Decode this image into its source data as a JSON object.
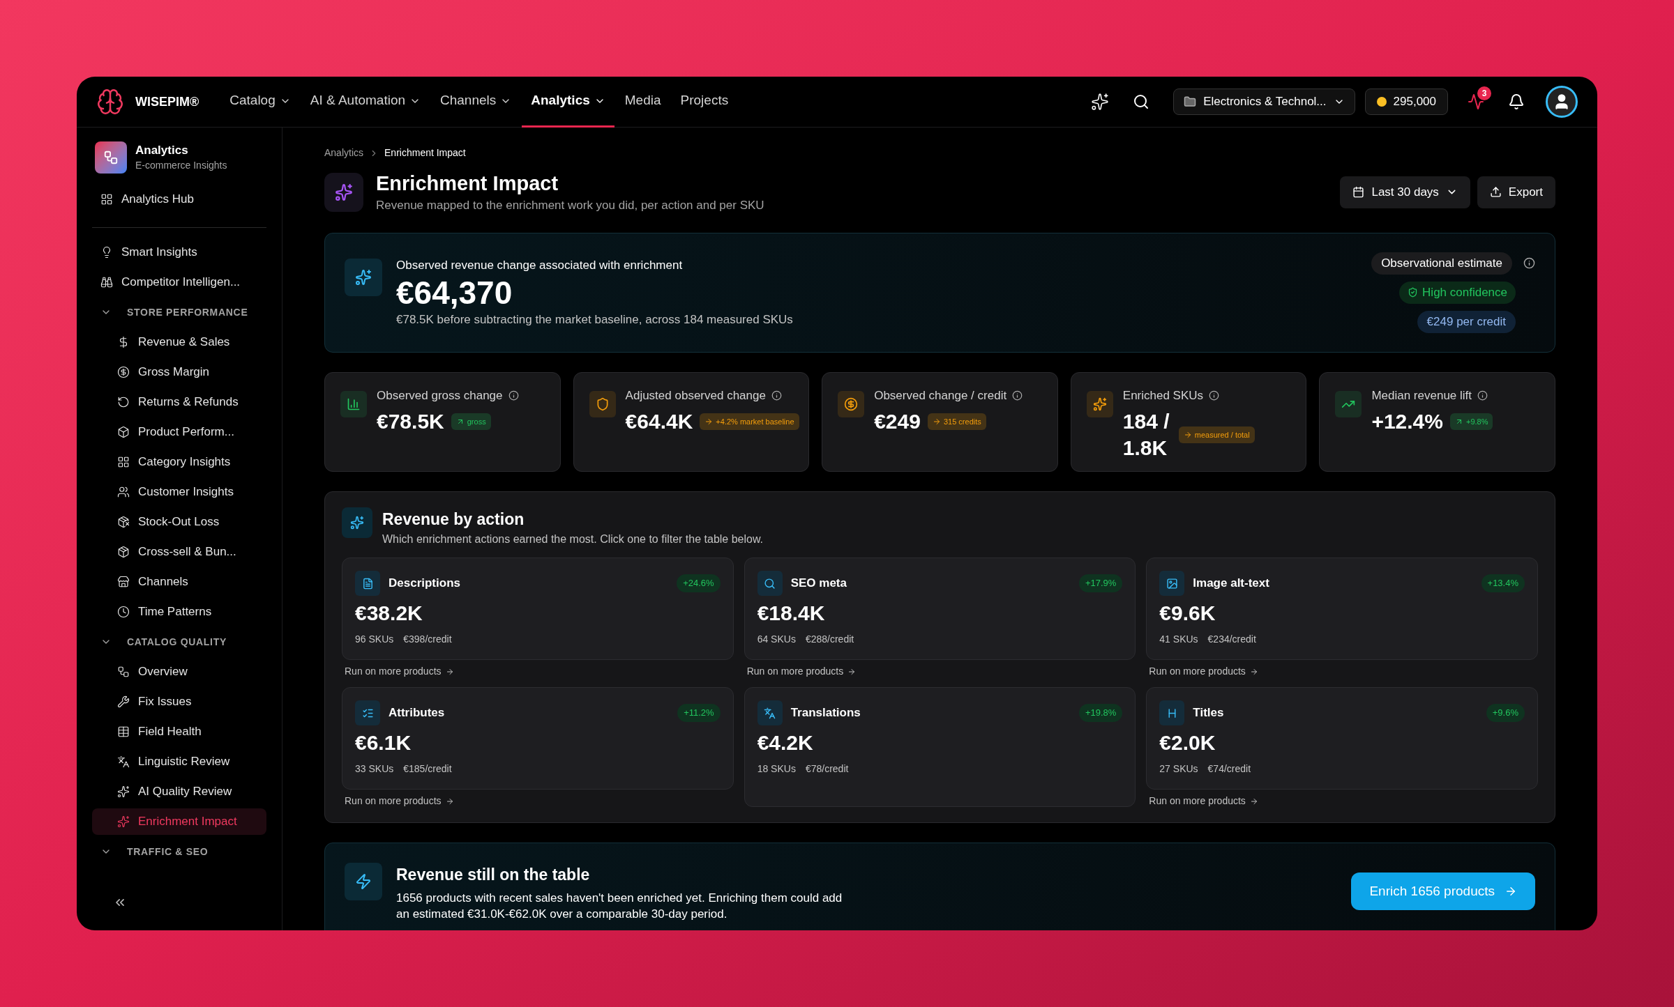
{
  "nav": {
    "brand": "WISEPIM®",
    "items": [
      {
        "label": "Catalog",
        "menu": true,
        "selected": false
      },
      {
        "label": "AI & Automation",
        "menu": true,
        "selected": false
      },
      {
        "label": "Channels",
        "menu": true,
        "selected": false
      },
      {
        "label": "Analytics",
        "menu": true,
        "selected": true
      },
      {
        "label": "Media",
        "menu": false,
        "selected": false
      },
      {
        "label": "Projects",
        "menu": false,
        "selected": false
      }
    ],
    "workspace": "Electronics & Technol...",
    "credits": "295,000",
    "notifications": "3"
  },
  "sidebar": {
    "title": "Analytics",
    "subtitle": "E-commerce Insights",
    "top": [
      {
        "label": "Analytics Hub",
        "selected": false
      }
    ],
    "items": [
      {
        "label": "Smart Insights",
        "selected": false
      },
      {
        "label": "Competitor Intelligen...",
        "selected": false
      }
    ],
    "sections": [
      {
        "label": "STORE PERFORMANCE",
        "expanded": true,
        "children": [
          {
            "label": "Revenue & Sales",
            "selected": false
          },
          {
            "label": "Gross Margin",
            "selected": false
          },
          {
            "label": "Returns & Refunds",
            "selected": false
          },
          {
            "label": "Product Perform...",
            "selected": false
          },
          {
            "label": "Category Insights",
            "selected": false
          },
          {
            "label": "Customer Insights",
            "selected": false
          },
          {
            "label": "Stock-Out Loss",
            "selected": false
          },
          {
            "label": "Cross-sell & Bun...",
            "selected": false
          },
          {
            "label": "Channels",
            "selected": false
          },
          {
            "label": "Time Patterns",
            "selected": false
          }
        ]
      },
      {
        "label": "CATALOG QUALITY",
        "expanded": true,
        "children": [
          {
            "label": "Overview",
            "selected": false
          },
          {
            "label": "Fix Issues",
            "selected": false
          },
          {
            "label": "Field Health",
            "selected": false
          },
          {
            "label": "Linguistic Review",
            "selected": false
          },
          {
            "label": "AI Quality Review",
            "selected": false
          },
          {
            "label": "Enrichment Impact",
            "selected": true
          }
        ]
      },
      {
        "label": "TRAFFIC & SEO",
        "expanded": true
      }
    ]
  },
  "breadcrumb": [
    "Analytics",
    "Enrichment Impact"
  ],
  "header": {
    "title": "Enrichment Impact",
    "subtitle": "Revenue mapped to the enrichment work you did, per action and per SKU",
    "period": "Last 30 days",
    "export": "Export"
  },
  "hero": {
    "label": "Observed revenue change associated with enrichment",
    "value": "€64,370",
    "note": "€78.5K before subtracting the market baseline, across 184 measured SKUs",
    "estimate": "Observational estimate",
    "confidence": "High confidence",
    "per_credit": "€249 per credit"
  },
  "kpis": [
    {
      "label": "Observed gross change",
      "value": "€78.5K",
      "badge": "gross",
      "kind": "up",
      "color": "#22c55e"
    },
    {
      "label": "Adjusted observed change",
      "value": "€64.4K",
      "badge": "+4.2% market baseline",
      "kind": "flat",
      "color": "#f59e0b"
    },
    {
      "label": "Observed change / credit",
      "value": "€249",
      "badge": "315 credits",
      "kind": "flat",
      "color": "#f59e0b"
    },
    {
      "label": "Enriched SKUs",
      "value": "184 / 1.8K",
      "badge": "measured / total",
      "kind": "flat",
      "color": "#f59e0b"
    },
    {
      "label": "Median revenue lift",
      "value": "+12.4%",
      "badge": "+9.8%",
      "kind": "up",
      "color": "#22c55e"
    }
  ],
  "actions": {
    "title": "Revenue by action",
    "subtitle": "Which enrichment actions earned the most. Click one to filter the table below.",
    "cards": [
      {
        "title": "Descriptions",
        "lift": "+24.6%",
        "value": "€38.2K",
        "skus": "96 SKUs",
        "per_credit": "€398/credit",
        "link": "Run on more products"
      },
      {
        "title": "SEO meta",
        "lift": "+17.9%",
        "value": "€18.4K",
        "skus": "64 SKUs",
        "per_credit": "€288/credit",
        "link": "Run on more products"
      },
      {
        "title": "Image alt-text",
        "lift": "+13.4%",
        "value": "€9.6K",
        "skus": "41 SKUs",
        "per_credit": "€234/credit",
        "link": "Run on more products"
      },
      {
        "title": "Attributes",
        "lift": "+11.2%",
        "value": "€6.1K",
        "skus": "33 SKUs",
        "per_credit": "€185/credit",
        "link": "Run on more products"
      },
      {
        "title": "Translations",
        "lift": "+19.8%",
        "value": "€4.2K",
        "skus": "18 SKUs",
        "per_credit": "€78/credit"
      },
      {
        "title": "Titles",
        "lift": "+9.6%",
        "value": "€2.0K",
        "skus": "27 SKUs",
        "per_credit": "€74/credit",
        "link": "Run on more products"
      }
    ]
  },
  "opportunity": {
    "title": "Revenue still on the table",
    "text": "1656 products with recent sales haven't been enriched yet. Enriching them could add an estimated €31.0K-€62.0K over a comparable 30-day period.",
    "button": "Enrich 1656 products"
  }
}
